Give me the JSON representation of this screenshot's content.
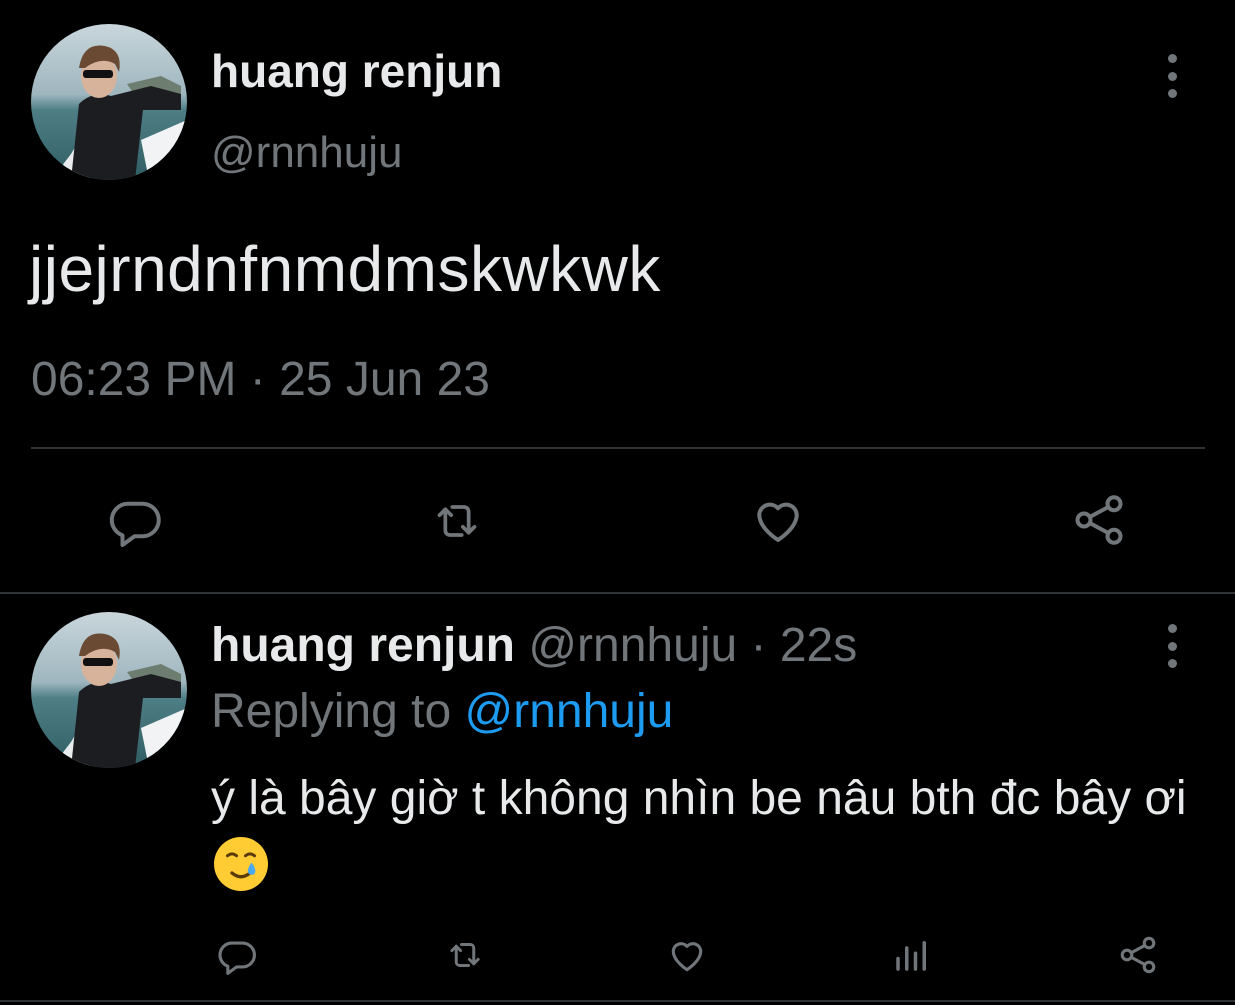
{
  "main_tweet": {
    "author_name": "huang renjun",
    "author_handle": "@rnnhuju",
    "text": "jjejrndnfnmdmskwkwk",
    "timestamp": "06:23 PM · 25 Jun 23",
    "actions": [
      "reply-icon",
      "retweet-icon",
      "like-icon",
      "share-icon"
    ]
  },
  "reply_tweet": {
    "author_name": "huang renjun",
    "author_handle": "@rnnhuju",
    "separator": "·",
    "time_ago": "22s",
    "replying_to_label": "Replying to",
    "replying_to_handle": "@rnnhuju",
    "text": "ý là bây giờ t không nhìn be nâu bth đc bây ơi",
    "emoji": "smiling-face-with-tear",
    "actions": [
      "reply-icon",
      "retweet-icon",
      "like-icon",
      "views-icon",
      "share-icon"
    ]
  },
  "colors": {
    "background": "#000000",
    "text_primary": "#e7e9ea",
    "text_secondary": "#71767b",
    "link": "#1d9bf0",
    "divider": "#2f3336"
  }
}
